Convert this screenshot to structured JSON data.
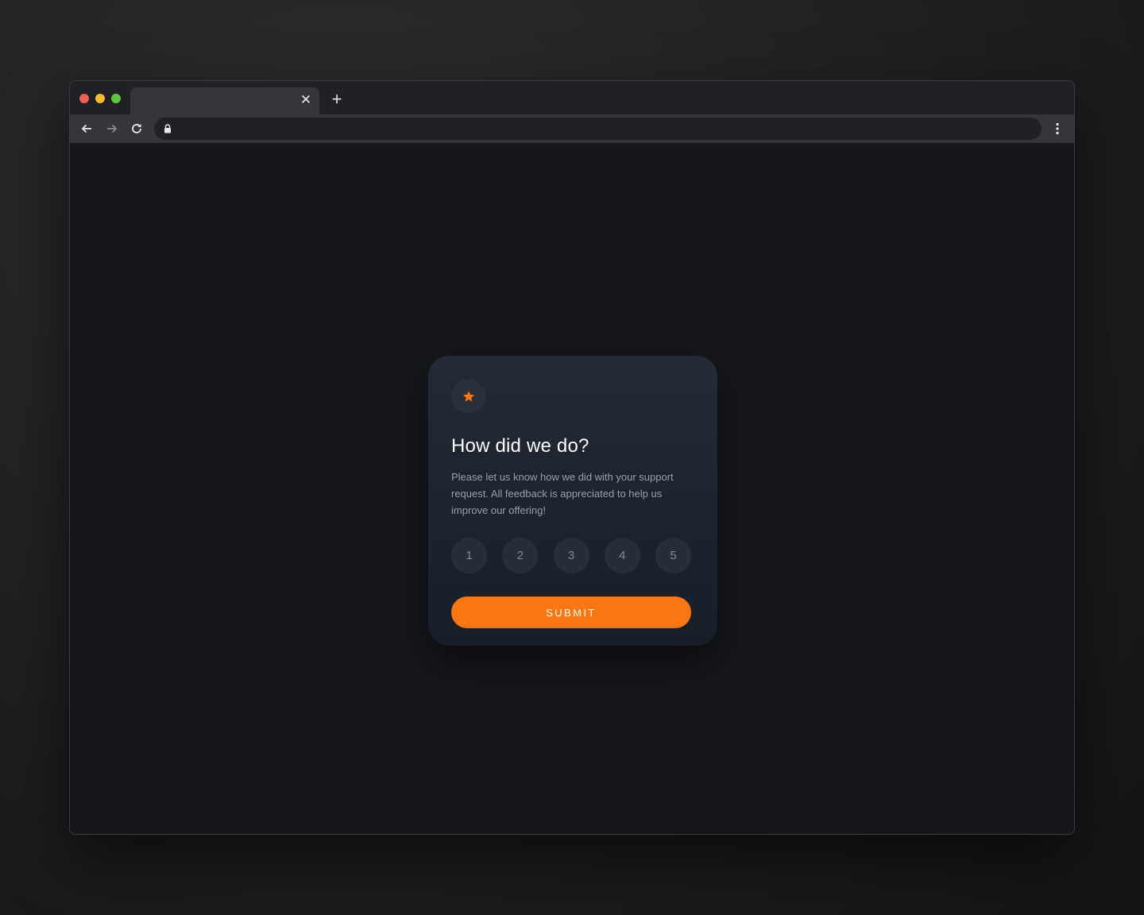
{
  "browser": {
    "tab_title": "",
    "tab_close_icon": "close-icon",
    "new_tab_icon": "plus-icon",
    "address": "",
    "icons": {
      "back": "arrow-left-icon",
      "forward": "arrow-right-icon",
      "reload": "reload-icon",
      "lock": "lock-icon",
      "menu": "more-vert-icon"
    }
  },
  "card": {
    "icon": "star-icon",
    "title": "How did we do?",
    "description": "Please let us know how we did with your support request. All feedback is appreciated to help us improve our offering!",
    "ratings": [
      "1",
      "2",
      "3",
      "4",
      "5"
    ],
    "submit_label": "SUBMIT"
  },
  "colors": {
    "accent": "#fc7614",
    "card_bg": "#232a34",
    "page_bg": "#15171b",
    "text_muted": "#959eac"
  }
}
